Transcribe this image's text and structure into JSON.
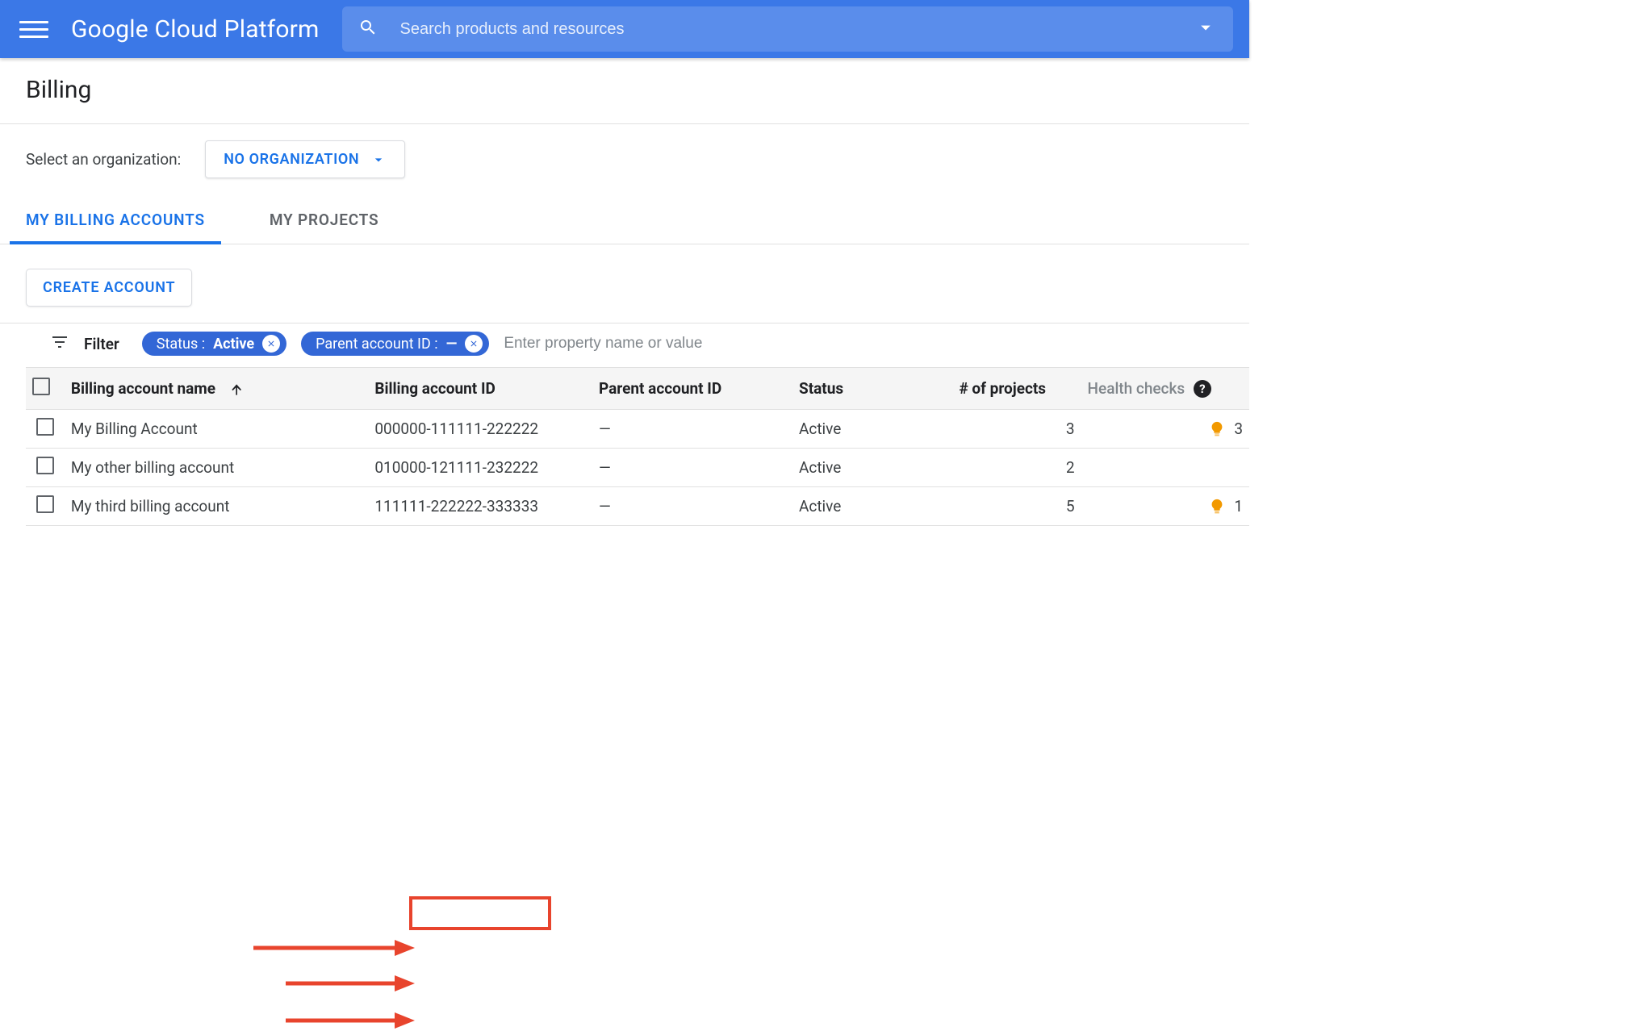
{
  "brand": "Google Cloud Platform",
  "search": {
    "placeholder": "Search products and resources"
  },
  "page_title": "Billing",
  "org": {
    "label": "Select an organization:",
    "selected": "NO ORGANIZATION"
  },
  "tabs": [
    {
      "label": "MY BILLING ACCOUNTS",
      "active": true
    },
    {
      "label": "MY PROJECTS",
      "active": false
    }
  ],
  "create_button": "CREATE ACCOUNT",
  "filter": {
    "label": "Filter",
    "chips": [
      {
        "key": "Status : ",
        "value": "Active"
      },
      {
        "key": "Parent account ID : ",
        "value": "—"
      }
    ],
    "placeholder": "Enter property name or value"
  },
  "table": {
    "columns": {
      "name": "Billing account name",
      "id": "Billing account ID",
      "parent": "Parent account ID",
      "status": "Status",
      "projects": "# of projects",
      "health": "Health checks"
    },
    "rows": [
      {
        "name": "My Billing Account",
        "id": "000000-111111-222222",
        "parent": "—",
        "status": "Active",
        "projects": "3",
        "health_tips": "3"
      },
      {
        "name": "My other billing account",
        "id": "010000-121111-232222",
        "parent": "—",
        "status": "Active",
        "projects": "2",
        "health_tips": ""
      },
      {
        "name": "My third billing account",
        "id": "111111-222222-333333",
        "parent": "—",
        "status": "Active",
        "projects": "5",
        "health_tips": "1"
      }
    ]
  },
  "colors": {
    "brand_blue": "#3b78e7",
    "link_blue": "#1a73e8",
    "chip_blue": "#3367d6",
    "annotation_red": "#e8442d",
    "bulb_orange": "#f29900"
  }
}
